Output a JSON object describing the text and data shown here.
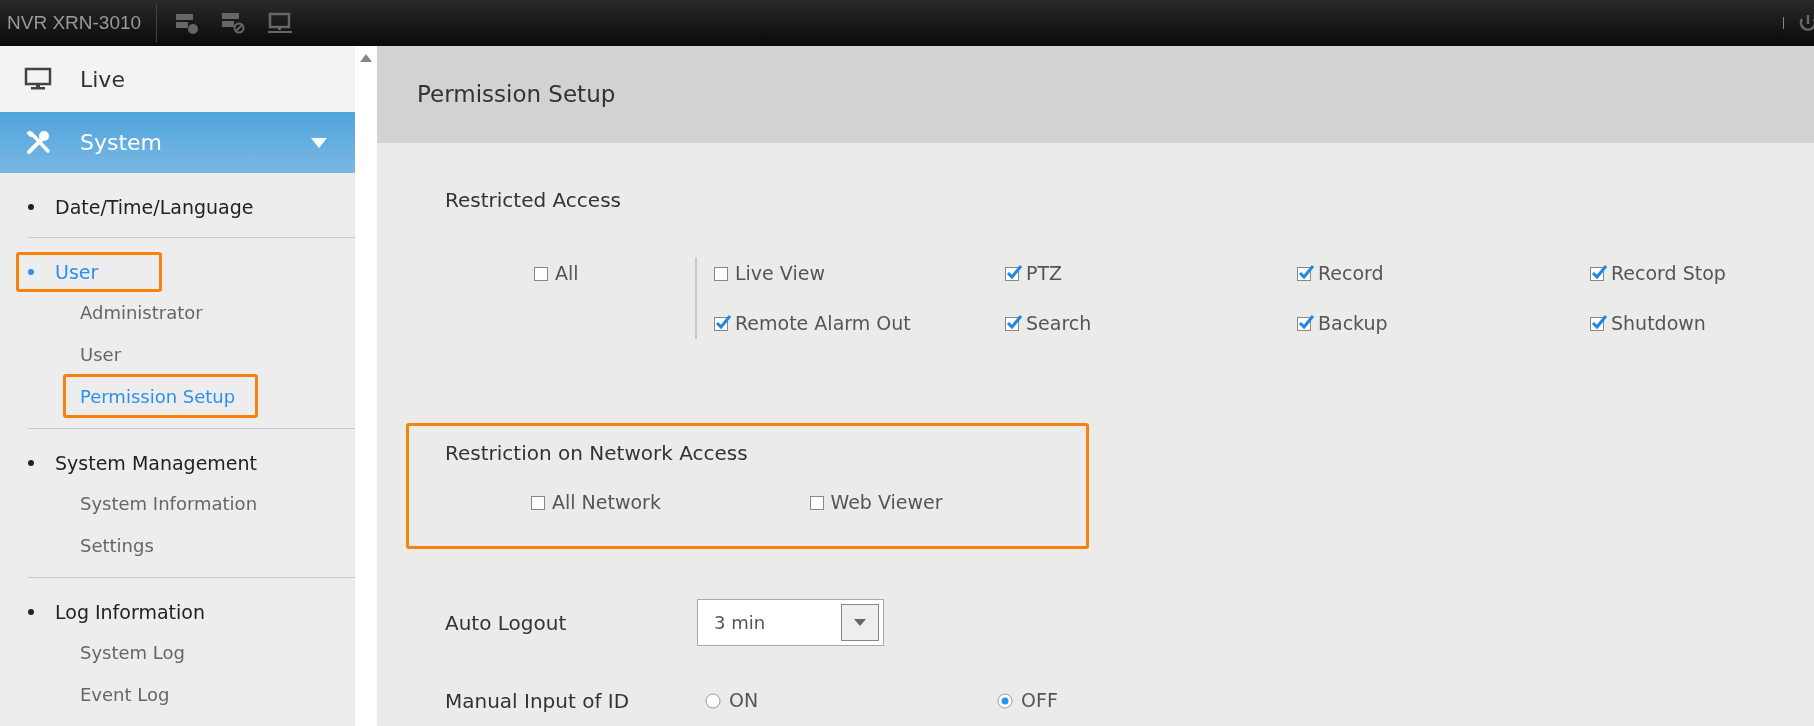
{
  "top_bar": {
    "title": "NVR XRN-3010"
  },
  "sidebar": {
    "menus": [
      {
        "label": "Live",
        "selected": false
      },
      {
        "label": "System",
        "selected": true,
        "expanded": true
      }
    ],
    "groups": [
      {
        "label": "Date/Time/Language",
        "selected": false,
        "highlighted": false
      },
      {
        "label": "User",
        "selected": true,
        "highlighted": true,
        "children": [
          {
            "label": "Administrator",
            "selected": false,
            "highlighted": false
          },
          {
            "label": "User",
            "selected": false,
            "highlighted": false
          },
          {
            "label": "Permission Setup",
            "selected": true,
            "highlighted": true
          }
        ]
      },
      {
        "label": "System Management",
        "selected": false,
        "highlighted": false,
        "children": [
          {
            "label": "System Information",
            "selected": false,
            "highlighted": false
          },
          {
            "label": "Settings",
            "selected": false,
            "highlighted": false
          }
        ]
      },
      {
        "label": "Log Information",
        "selected": false,
        "highlighted": false,
        "children": [
          {
            "label": "System Log",
            "selected": false,
            "highlighted": false
          },
          {
            "label": "Event Log",
            "selected": false,
            "highlighted": false
          }
        ]
      }
    ]
  },
  "page": {
    "title": "Permission Setup",
    "restricted_access": {
      "title": "Restricted Access",
      "all": {
        "label": "All",
        "checked": false
      },
      "options": [
        {
          "label": "Live View",
          "checked": false
        },
        {
          "label": "PTZ",
          "checked": true
        },
        {
          "label": "Record",
          "checked": true
        },
        {
          "label": "Record Stop",
          "checked": true
        },
        {
          "label": "Remote Alarm Out",
          "checked": true
        },
        {
          "label": "Search",
          "checked": true
        },
        {
          "label": "Backup",
          "checked": true
        },
        {
          "label": "Shutdown",
          "checked": true
        }
      ]
    },
    "network_access": {
      "title": "Restriction on Network Access",
      "highlighted": true,
      "options": [
        {
          "label": "All Network",
          "checked": false
        },
        {
          "label": "Web Viewer",
          "checked": false
        }
      ]
    },
    "auto_logout": {
      "label": "Auto Logout",
      "value": "3 min"
    },
    "manual_input": {
      "label": "Manual Input of ID",
      "options": [
        {
          "label": "ON",
          "selected": false
        },
        {
          "label": "OFF",
          "selected": true
        }
      ]
    }
  }
}
